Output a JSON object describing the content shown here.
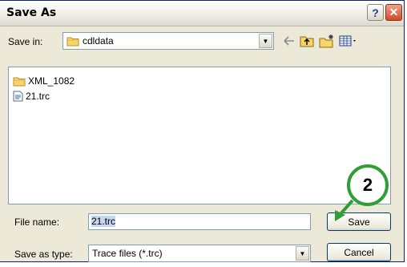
{
  "dialog": {
    "title": "Save As",
    "help_glyph": "?",
    "close_glyph": "✕"
  },
  "save_in": {
    "label": "Save in:",
    "value": "cdldata",
    "folder_icon": "folder-icon"
  },
  "toolbar": {
    "items": [
      "back-arrow-icon",
      "up-folder-icon",
      "new-folder-icon",
      "view-menu-icon"
    ]
  },
  "files": [
    {
      "name": "XML_1082",
      "icon": "folder-icon"
    },
    {
      "name": "21.trc",
      "icon": "file-icon"
    }
  ],
  "file_name": {
    "label": "File name:",
    "value": "21.trc"
  },
  "save_as_type": {
    "label": "Save as type:",
    "value": "Trace files (*.trc)"
  },
  "buttons": {
    "save": "Save",
    "cancel": "Cancel"
  },
  "annotation": {
    "step_number": "2",
    "color": "#2f9e34"
  }
}
